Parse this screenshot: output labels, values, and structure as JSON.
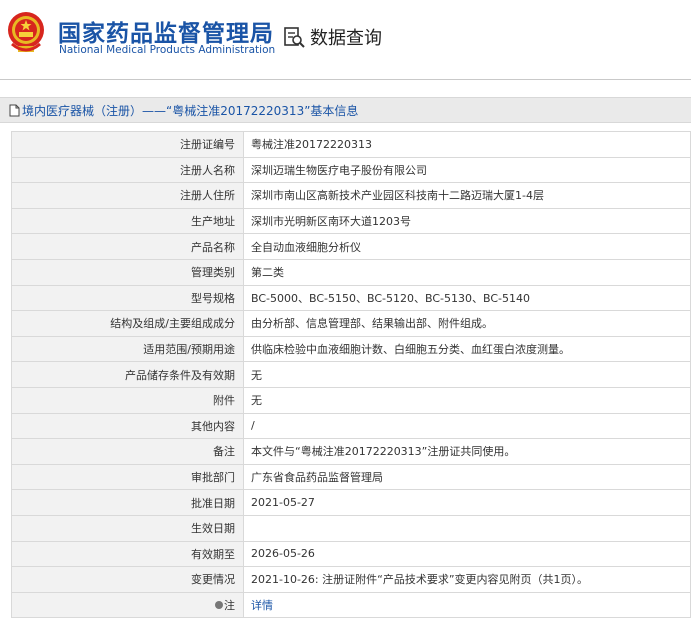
{
  "header": {
    "title_cn": "国家药品监督管理局",
    "title_en": "National Medical Products Administration",
    "query_label": "数据查询",
    "emblem_icon": "national-emblem-icon",
    "query_icon": "document-search-icon"
  },
  "breadcrumb": {
    "icon": "document-icon",
    "text": "境内医疗器械（注册）——“粤械注准20172220313”基本信息"
  },
  "colors": {
    "brand_blue": "#1a54a6",
    "label_bg": "#f2f2f2",
    "border": "#d9d9d9"
  },
  "rows": [
    {
      "label": "注册证编号",
      "value": "粤械注准20172220313"
    },
    {
      "label": "注册人名称",
      "value": "深圳迈瑞生物医疗电子股份有限公司"
    },
    {
      "label": "注册人住所",
      "value": "深圳市南山区高新技术产业园区科技南十二路迈瑞大厦1-4层"
    },
    {
      "label": "生产地址",
      "value": "深圳市光明新区南环大道1203号"
    },
    {
      "label": "产品名称",
      "value": "全自动血液细胞分析仪"
    },
    {
      "label": "管理类别",
      "value": "第二类"
    },
    {
      "label": "型号规格",
      "value": "BC-5000、BC-5150、BC-5120、BC-5130、BC-5140"
    },
    {
      "label": "结构及组成/主要组成成分",
      "value": "由分析部、信息管理部、结果输出部、附件组成。"
    },
    {
      "label": "适用范围/预期用途",
      "value": "供临床检验中血液细胞计数、白细胞五分类、血红蛋白浓度测量。"
    },
    {
      "label": "产品储存条件及有效期",
      "value": "无"
    },
    {
      "label": "附件",
      "value": "无"
    },
    {
      "label": "其他内容",
      "value": "/"
    },
    {
      "label": "备注",
      "value": "本文件与“粤械注准20172220313”注册证共同使用。"
    },
    {
      "label": "审批部门",
      "value": "广东省食品药品监督管理局"
    },
    {
      "label": "批准日期",
      "value": "2021-05-27"
    },
    {
      "label": "生效日期",
      "value": ""
    },
    {
      "label": "有效期至",
      "value": "2026-05-26"
    },
    {
      "label": "变更情况",
      "value": "2021-10-26: 注册证附件“产品技术要求”变更内容见附页（共1页）。"
    },
    {
      "label": "注",
      "value": "详情",
      "icon": "info-bullet-icon"
    }
  ]
}
